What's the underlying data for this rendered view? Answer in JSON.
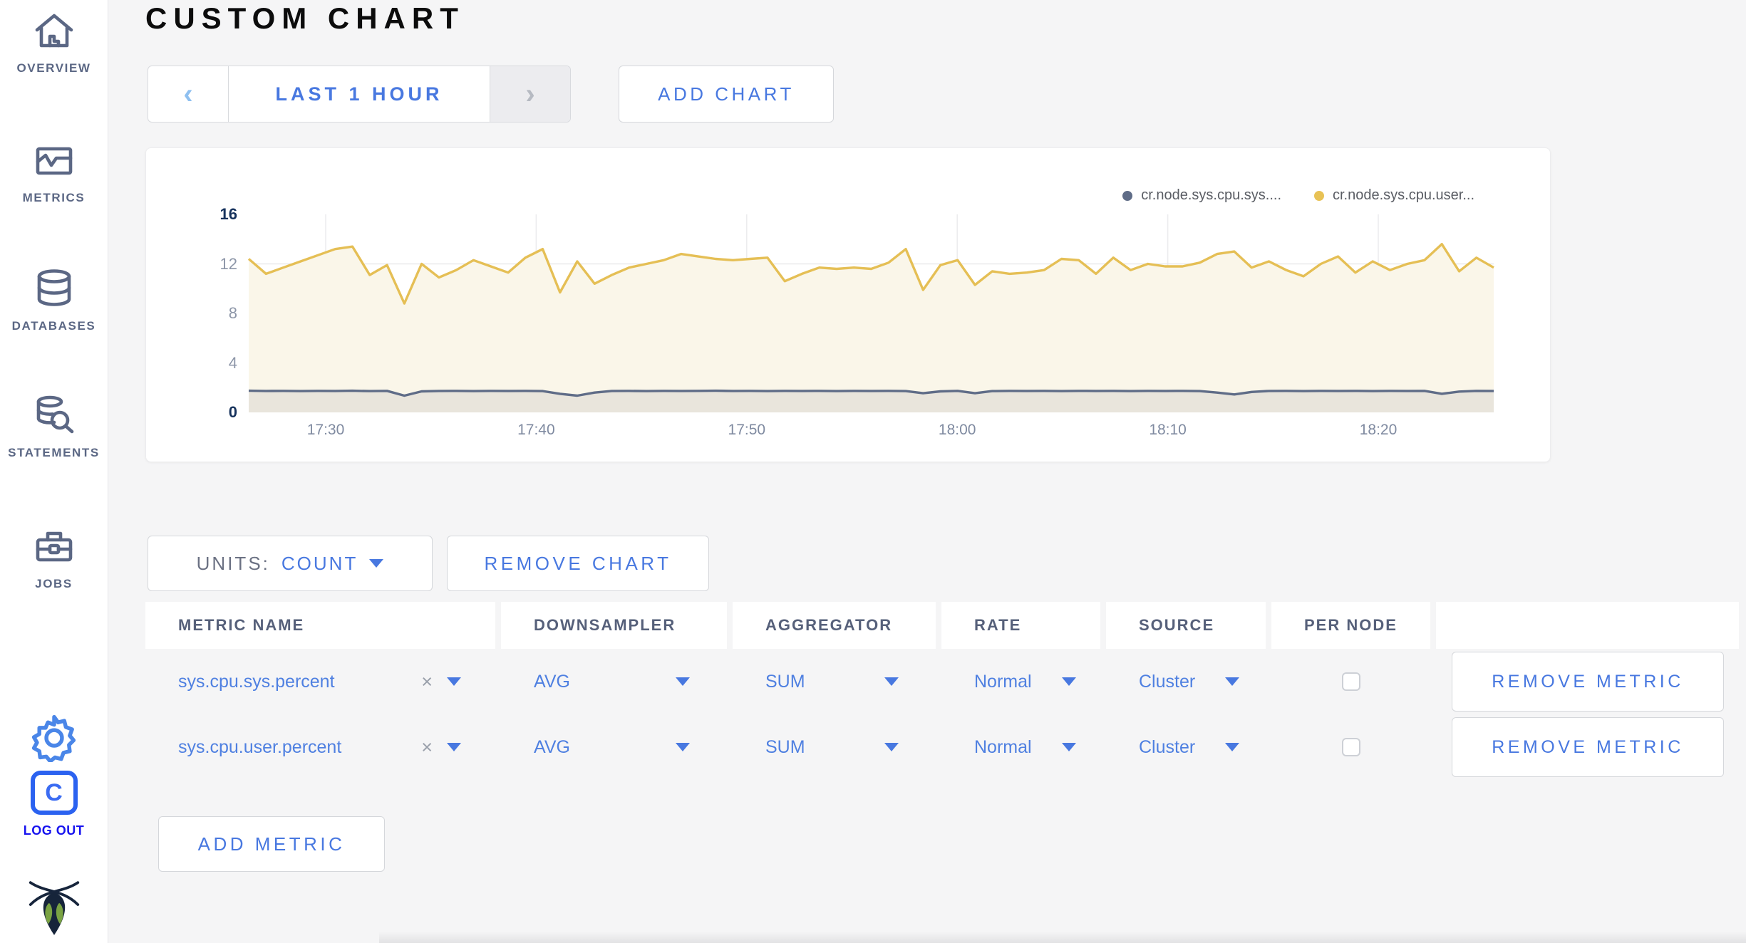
{
  "sidebar": {
    "items": [
      {
        "label": "OVERVIEW",
        "icon": "home-icon"
      },
      {
        "label": "METRICS",
        "icon": "metrics-icon"
      },
      {
        "label": "DATABASES",
        "icon": "database-icon"
      },
      {
        "label": "STATEMENTS",
        "icon": "statements-icon"
      },
      {
        "label": "JOBS",
        "icon": "jobs-icon"
      }
    ],
    "settings_icon": "gear-icon",
    "logout": {
      "label": "LOG OUT",
      "icon": "cockroach-c-icon"
    },
    "logo_icon": "cockroach-bug-logo"
  },
  "header": {
    "title": "CUSTOM CHART"
  },
  "time_selector": {
    "prev": "‹",
    "label": "LAST 1 HOUR",
    "next": "›"
  },
  "add_chart_label": "ADD CHART",
  "chart_data": {
    "type": "line",
    "title": "",
    "xlabel": "",
    "ylabel": "",
    "ylim": [
      0,
      16
    ],
    "y_ticks": [
      0,
      4,
      8,
      12,
      16
    ],
    "x_ticks": [
      "17:30",
      "17:40",
      "17:50",
      "18:00",
      "18:10",
      "18:20"
    ],
    "grid": true,
    "legend_position": "top-right",
    "legend": [
      {
        "label": "cr.node.sys.cpu.sys....",
        "color": "#5f6c87"
      },
      {
        "label": "cr.node.sys.cpu.user...",
        "color": "#e8c255"
      }
    ],
    "series": [
      {
        "name": "cr.node.sys.cpu.user...",
        "color": "#e5bf55",
        "fill": "#faf6e9",
        "values": [
          12.4,
          11.2,
          11.7,
          12.2,
          12.7,
          13.2,
          13.4,
          11.1,
          11.9,
          8.8,
          12.0,
          10.9,
          11.5,
          12.3,
          11.8,
          11.3,
          12.5,
          13.2,
          9.7,
          12.2,
          10.4,
          11.1,
          11.7,
          12.0,
          12.3,
          12.8,
          12.6,
          12.4,
          12.3,
          12.4,
          12.5,
          10.6,
          11.2,
          11.7,
          11.6,
          11.7,
          11.6,
          12.1,
          13.2,
          9.9,
          11.9,
          12.3,
          10.3,
          11.4,
          11.2,
          11.3,
          11.5,
          12.4,
          12.3,
          11.2,
          12.5,
          11.5,
          12.0,
          11.8,
          11.8,
          12.1,
          12.8,
          13.0,
          11.7,
          12.2,
          11.5,
          11.0,
          12.0,
          12.6,
          11.3,
          12.2,
          11.5,
          12.0,
          12.3,
          13.6,
          11.4,
          12.5,
          11.7
        ]
      },
      {
        "name": "cr.node.sys.cpu.sys....",
        "color": "#5f6c87",
        "fill": "#e9e5dc",
        "values": [
          1.75,
          1.73,
          1.74,
          1.72,
          1.74,
          1.73,
          1.75,
          1.72,
          1.74,
          1.35,
          1.7,
          1.73,
          1.74,
          1.72,
          1.74,
          1.73,
          1.74,
          1.72,
          1.5,
          1.35,
          1.6,
          1.73,
          1.74,
          1.72,
          1.74,
          1.73,
          1.74,
          1.75,
          1.73,
          1.74,
          1.72,
          1.74,
          1.73,
          1.74,
          1.72,
          1.74,
          1.73,
          1.74,
          1.72,
          1.55,
          1.7,
          1.74,
          1.55,
          1.72,
          1.74,
          1.73,
          1.74,
          1.72,
          1.74,
          1.73,
          1.74,
          1.72,
          1.74,
          1.73,
          1.74,
          1.72,
          1.6,
          1.45,
          1.65,
          1.73,
          1.74,
          1.72,
          1.74,
          1.73,
          1.74,
          1.72,
          1.74,
          1.73,
          1.74,
          1.5,
          1.68,
          1.74,
          1.73
        ]
      }
    ]
  },
  "units": {
    "label": "UNITS:",
    "value": "COUNT"
  },
  "remove_chart_label": "REMOVE CHART",
  "metrics_table": {
    "columns": [
      "METRIC NAME",
      "DOWNSAMPLER",
      "AGGREGATOR",
      "RATE",
      "SOURCE",
      "PER NODE",
      ""
    ],
    "remove_label": "REMOVE METRIC",
    "clear_glyph": "×",
    "rows": [
      {
        "metric": "sys.cpu.sys.percent",
        "downsampler": "AVG",
        "aggregator": "SUM",
        "rate": "Normal",
        "source": "Cluster",
        "per_node": false
      },
      {
        "metric": "sys.cpu.user.percent",
        "downsampler": "AVG",
        "aggregator": "SUM",
        "rate": "Normal",
        "source": "Cluster",
        "per_node": false
      }
    ]
  },
  "add_metric_label": "ADD METRIC",
  "colors": {
    "accent_blue": "#4878e0",
    "sidebar_slate": "#5b6784",
    "logout_blue": "#1713ef",
    "series_yellow": "#e5bf55",
    "series_slate": "#5f6c87",
    "page_bg": "#f5f5f6"
  }
}
